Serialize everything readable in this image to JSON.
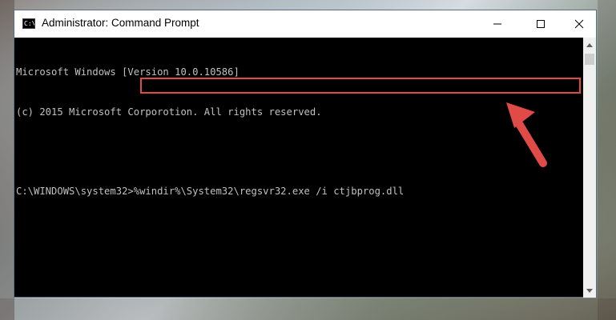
{
  "window": {
    "title": "Administrator: Command Prompt",
    "icon": "cmd-icon"
  },
  "controls": {
    "minimize": "minimize-icon",
    "maximize": "maximize-icon",
    "close": "close-icon"
  },
  "console": {
    "lines": [
      "Microsoft Windows [Version 10.0.10586]",
      "(c) 2015 Microsoft Corporotion. All rights reserved.",
      "",
      "C:\\WINDOWS\\system32>%windir%\\System32\\regsvr32.exe /i ctjbprog.dll"
    ]
  },
  "annotation": {
    "highlight_color": "#e04b47",
    "arrow_color": "#e04b47"
  }
}
